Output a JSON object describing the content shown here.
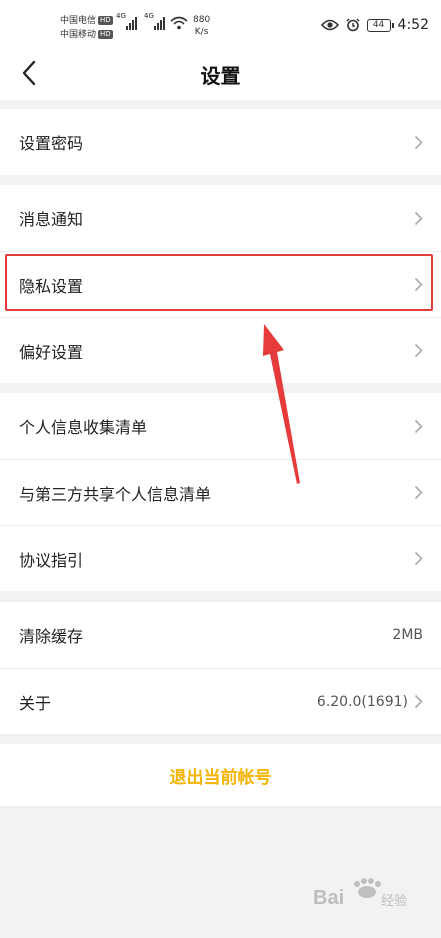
{
  "status_bar": {
    "carrier1": "中国电信",
    "carrier2": "中国移动",
    "hd": "HD",
    "network": "4G",
    "speed_value": "880",
    "speed_unit": "K/s",
    "battery": "44",
    "time": "4:52"
  },
  "header": {
    "title": "设置"
  },
  "groups": [
    [
      {
        "label": "设置密码"
      }
    ],
    [
      {
        "label": "消息通知"
      },
      {
        "label": "隐私设置"
      },
      {
        "label": "偏好设置"
      }
    ],
    [
      {
        "label": "个人信息收集清单"
      },
      {
        "label": "与第三方共享个人信息清单"
      },
      {
        "label": "协议指引"
      }
    ],
    [
      {
        "label": "清除缓存",
        "value": "2MB"
      },
      {
        "label": "关于",
        "value": "6.20.0(1691)"
      }
    ]
  ],
  "logout_label": "退出当前帐号",
  "colors": {
    "accent": "#f5b400",
    "highlight": "#e33a3a"
  },
  "watermark": {
    "text": "Bai",
    "subtext": "经验"
  }
}
